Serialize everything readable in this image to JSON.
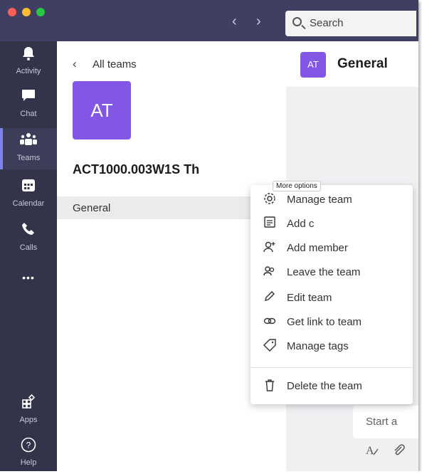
{
  "titlebar": {
    "back_arrow": "‹",
    "forward_arrow": "›",
    "search": {
      "label": "Search",
      "icon": "search-icon"
    }
  },
  "rail": {
    "items": [
      {
        "label": "Activity",
        "icon": "bell-icon"
      },
      {
        "label": "Chat",
        "icon": "chat-icon"
      },
      {
        "label": "Teams",
        "icon": "teams-icon"
      },
      {
        "label": "Calendar",
        "icon": "calendar-icon"
      },
      {
        "label": "Calls",
        "icon": "phone-icon"
      },
      {
        "label": "",
        "icon": "more-icon"
      },
      {
        "label": "Apps",
        "icon": "apps-icon"
      },
      {
        "label": "Help",
        "icon": "help-icon"
      }
    ],
    "more_glyph": "•••"
  },
  "panel": {
    "back_label": "All teams",
    "avatar_initials": "AT",
    "team_name": "ACT1000.003W1S Th",
    "channels": [
      {
        "label": "General"
      }
    ]
  },
  "chat": {
    "avatar_initials": "AT",
    "channel_title": "General",
    "compose_placeholder": "Start a",
    "format_icons": [
      "format-icon",
      "attach-icon"
    ]
  },
  "tooltip": {
    "text": "More options"
  },
  "menu": {
    "items": [
      {
        "label": "Manage team",
        "icon": "gear-icon"
      },
      {
        "label": "Add c",
        "icon": "add-channel-icon"
      },
      {
        "label": "Add member",
        "icon": "add-member-icon"
      },
      {
        "label": "Leave the team",
        "icon": "leave-icon"
      },
      {
        "label": "Edit team",
        "icon": "pencil-icon"
      },
      {
        "label": "Get link to team",
        "icon": "link-icon"
      },
      {
        "label": "Manage tags",
        "icon": "tag-icon"
      },
      {
        "label": "Delete the team",
        "icon": "trash-icon"
      }
    ]
  },
  "colors": {
    "titlebar": "#3e3f62",
    "rail": "#33344a",
    "accent": "#8257e6",
    "active_indicator": "#7b83eb"
  }
}
